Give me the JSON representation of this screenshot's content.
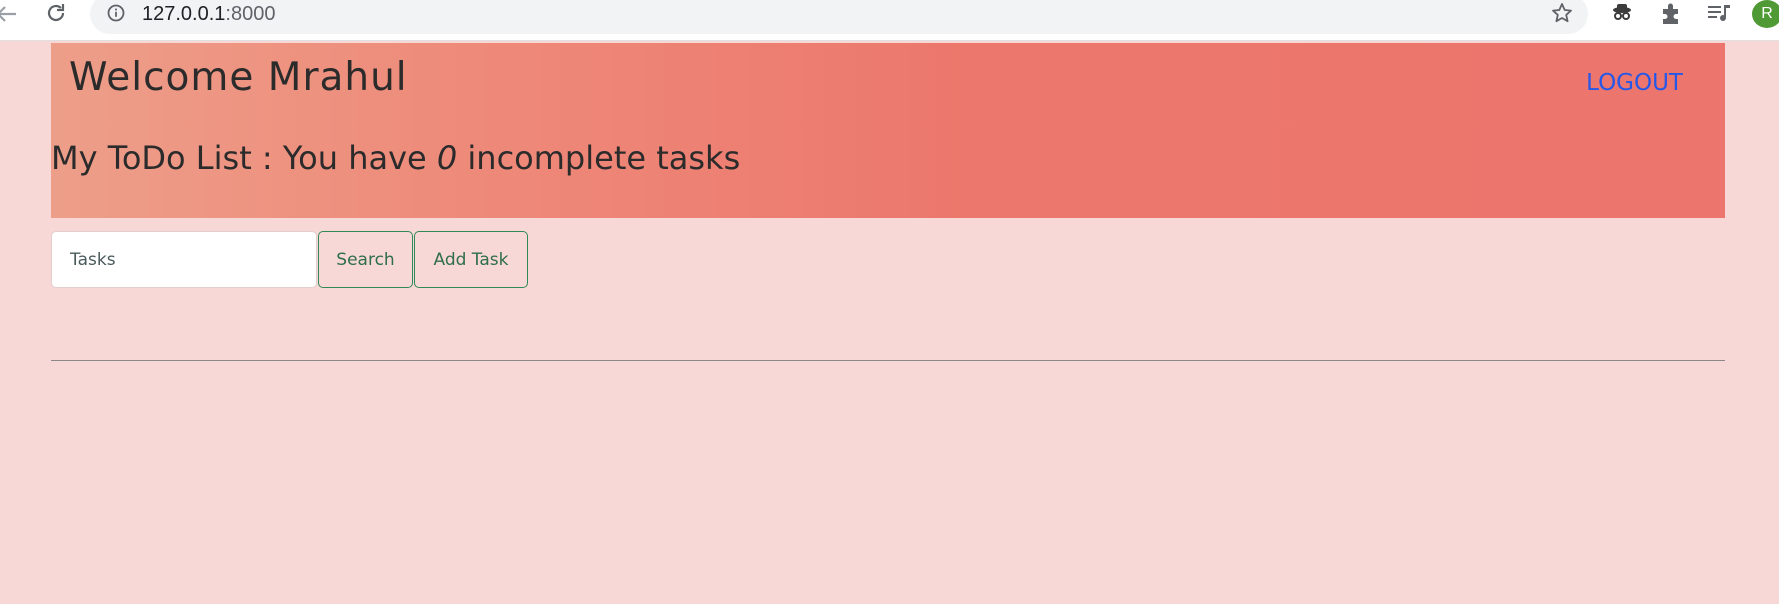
{
  "browser": {
    "url_host": "127.0.0.1",
    "url_port": ":8000",
    "profile_initial": "R",
    "icons": [
      "back-arrow-icon",
      "reload-icon",
      "info-icon",
      "star-icon",
      "extension-spy-icon",
      "puzzle-extensions-icon",
      "media-queue-icon"
    ]
  },
  "header": {
    "welcome_text": "Welcome Mrahul",
    "logout_label": "LOGOUT",
    "todo_prefix": "My ToDo List : You have ",
    "incomplete_count": "0",
    "todo_suffix": " incomplete tasks"
  },
  "form": {
    "input_placeholder": "Tasks",
    "input_value": "",
    "search_label": "Search",
    "add_label": "Add Task"
  },
  "colors": {
    "page_background": "#f8d7d7",
    "banner_gradient_start": "#ed9e89",
    "banner_gradient_end": "#ec766d",
    "logout_link": "#2557e8",
    "button_border": "#2f8a57"
  }
}
